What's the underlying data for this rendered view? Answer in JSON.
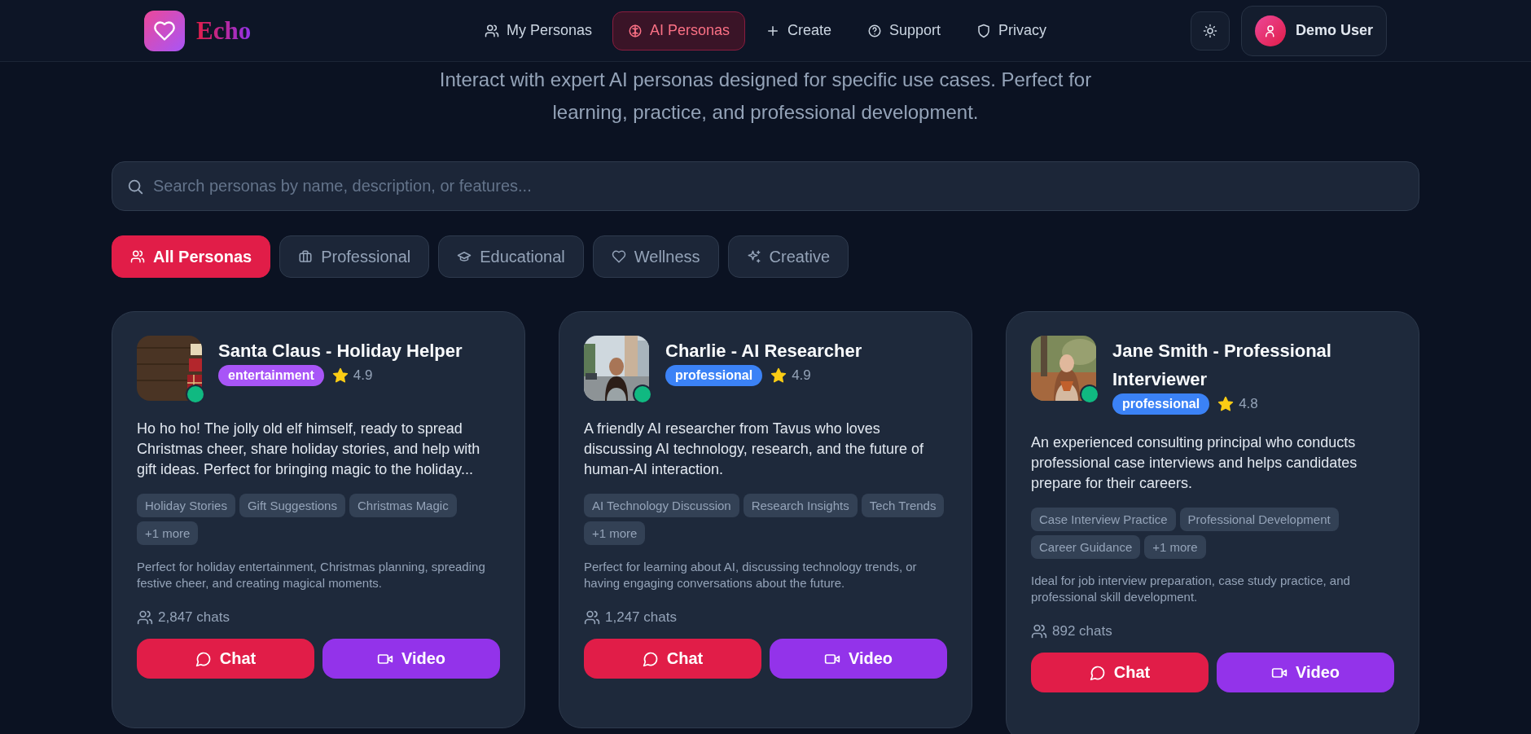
{
  "header": {
    "logo_text": "Echo",
    "nav": [
      {
        "label": "My Personas",
        "selected": false
      },
      {
        "label": "AI Personas",
        "selected": true
      },
      {
        "label": "Create",
        "selected": false
      },
      {
        "label": "Support",
        "selected": false
      },
      {
        "label": "Privacy",
        "selected": false
      }
    ],
    "user": {
      "name": "Demo User"
    }
  },
  "subtitle": "Interact with expert AI personas designed for specific use cases. Perfect for learning, practice, and professional development.",
  "search": {
    "placeholder": "Search personas by name, description, or features..."
  },
  "filters": [
    {
      "label": "All Personas",
      "selected": true
    },
    {
      "label": "Professional",
      "selected": false
    },
    {
      "label": "Educational",
      "selected": false
    },
    {
      "label": "Wellness",
      "selected": false
    },
    {
      "label": "Creative",
      "selected": false
    }
  ],
  "personas": [
    {
      "name": "Santa Claus - Holiday Helper",
      "online": true,
      "category": {
        "label": "entertainment",
        "color": "#a855f7"
      },
      "rating": "4.9",
      "description": "Ho ho ho! The jolly old elf himself, ready to spread Christmas cheer, share holiday stories, and help with gift ideas. Perfect for bringing magic to the holiday...",
      "tags": [
        "Holiday Stories",
        "Gift Suggestions",
        "Christmas Magic",
        "+1 more"
      ],
      "use_case": "Perfect for holiday entertainment, Christmas planning, spreading festive cheer, and creating magical moments.",
      "chats": "2,847 chats",
      "buttons": [
        "Chat",
        "Video"
      ]
    },
    {
      "name": "Charlie - AI Researcher",
      "online": true,
      "category": {
        "label": "professional",
        "color": "#3b82f6"
      },
      "rating": "4.9",
      "description": "A friendly AI researcher from Tavus who loves discussing AI technology, research, and the future of human-AI interaction.",
      "tags": [
        "AI Technology Discussion",
        "Research Insights",
        "Tech Trends",
        "+1 more"
      ],
      "use_case": "Perfect for learning about AI, discussing technology trends, or having engaging conversations about the future.",
      "chats": "1,247 chats",
      "buttons": [
        "Chat",
        "Video"
      ]
    },
    {
      "name": "Jane Smith - Professional Interviewer",
      "online": true,
      "category": {
        "label": "professional",
        "color": "#3b82f6"
      },
      "rating": "4.8",
      "description": "An experienced consulting principal who conducts professional case interviews and helps candidates prepare for their careers.",
      "tags": [
        "Case Interview Practice",
        "Professional Development",
        "Career Guidance",
        "+1 more"
      ],
      "use_case": "Ideal for job interview preparation, case study practice, and professional skill development.",
      "chats": "892 chats",
      "buttons": [
        "Chat",
        "Video"
      ]
    }
  ]
}
